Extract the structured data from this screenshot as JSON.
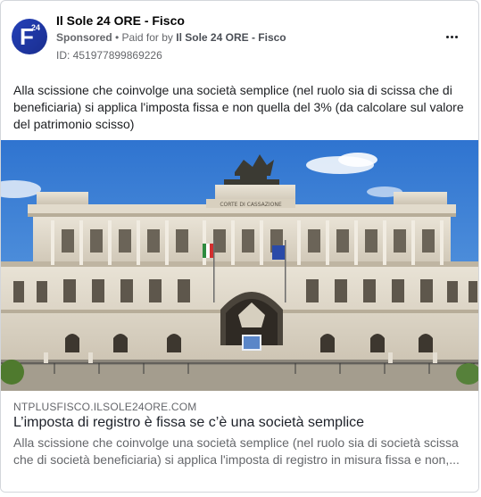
{
  "post": {
    "page_name": "Il Sole 24 ORE - Fisco",
    "avatar": {
      "letter": "F",
      "superscript": "24",
      "color": "#2440b8"
    },
    "sponsored_label": "Sponsored",
    "separator": " • ",
    "paid_for_by_prefix": "Paid for by ",
    "paid_for_by_name": "Il Sole 24 ORE - Fisco",
    "ad_id": "ID: 451977899869226",
    "body_text": "Alla scissione che coinvolge una società semplice (nel ruolo sia di scissa che di beneficiaria) si applica l'imposta fissa e non quella del 3% (da calcolare sul valore del patrimonio scisso)",
    "more_icon": "more-horizontal-icon"
  },
  "link_preview": {
    "domain": "NTPLUSFISCO.ILSOLE24ORE.COM",
    "title": "L’imposta di registro è fissa se c’è una società semplice",
    "description": "Alla scissione che coinvolge una società semplice (nel ruolo sia di società scissa che di società beneficiaria) si applica l'imposta di registro in misura fissa e non,...",
    "image_building_inscription": "CORTE DI CASSAZIONE"
  }
}
